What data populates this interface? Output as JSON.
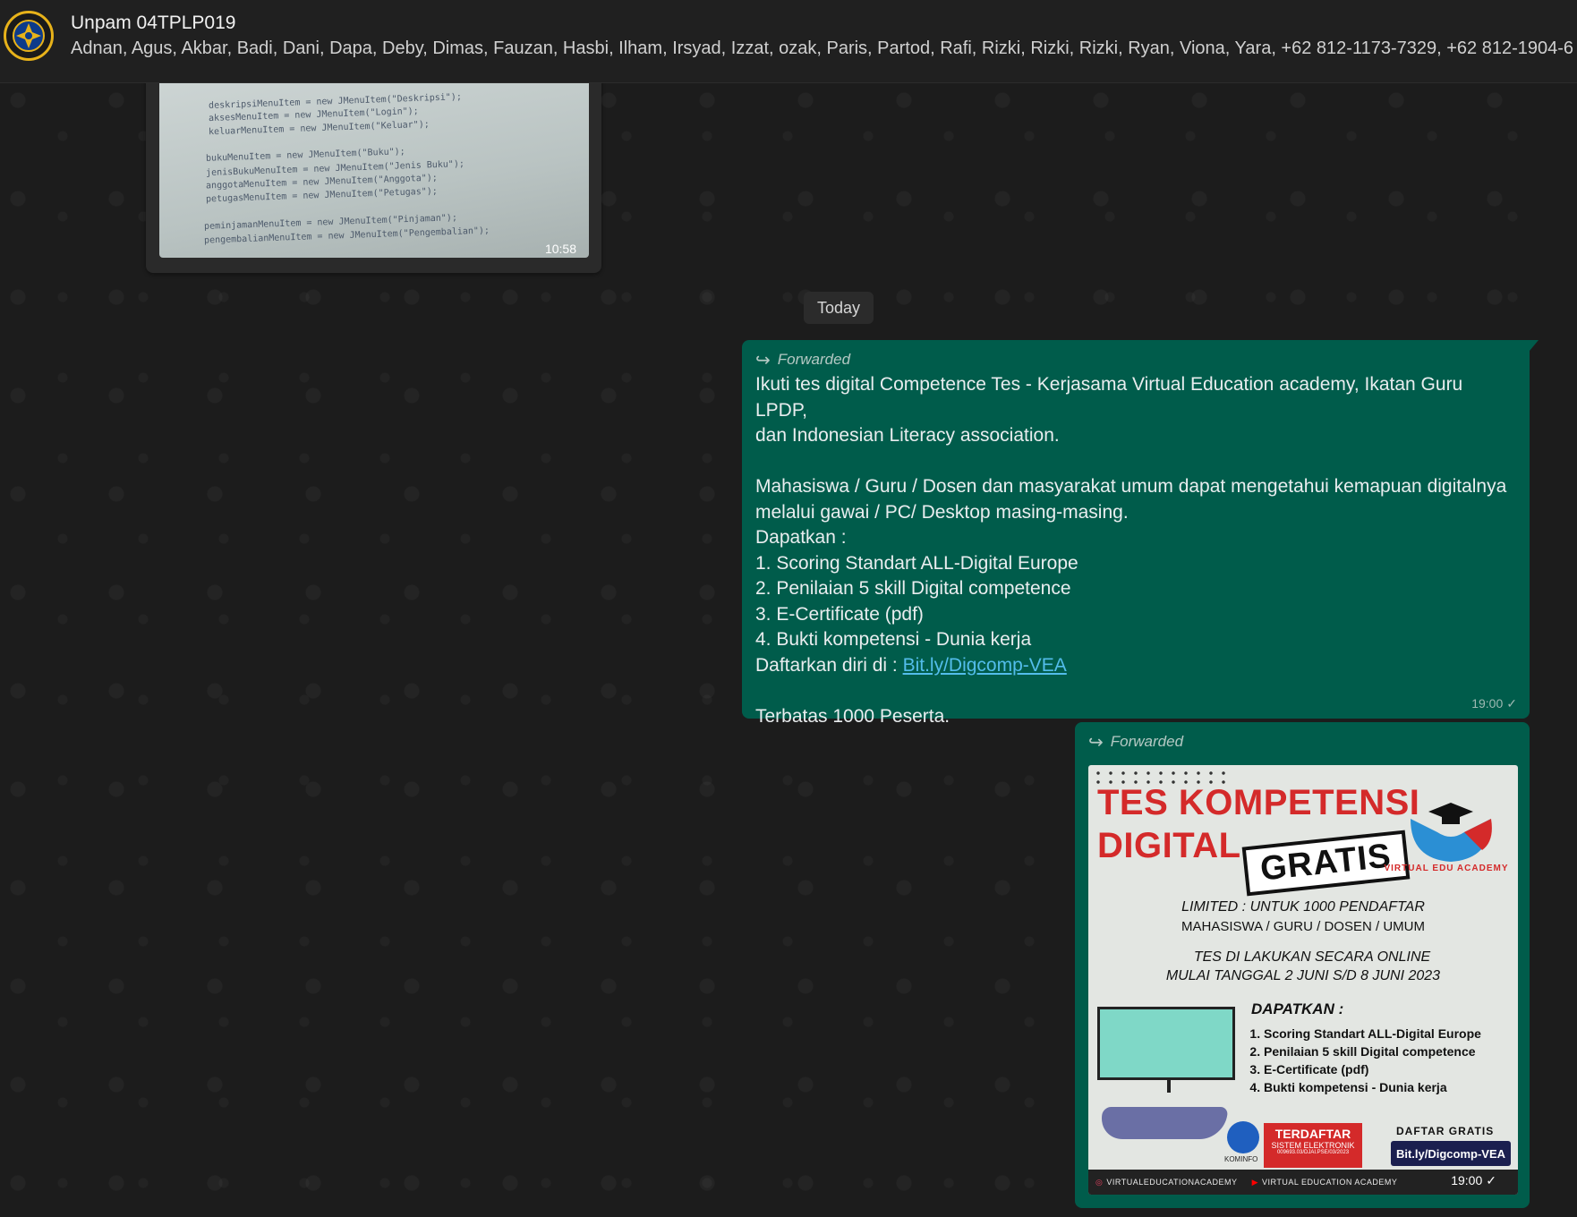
{
  "header": {
    "title": "Unpam 04TPLP019",
    "members": "Adnan, Agus, Akbar, Badi, Dani, Dapa, Deby, Dimas, Fauzan, Hasbi, Ilham, Irsyad, Izzat, ozak, Paris, Partod, Rafi, Rizki, Rizki, Rizki, Ryan, Viona, Yara, +62 812-1173-7329, +62 812-1904-6"
  },
  "old_image": {
    "time": "10:58",
    "code_lines": [
      "deskripsiMenuItem = new JMenuItem(\"Deskripsi\");",
      "aksesMenuItem = new JMenuItem(\"Login\");",
      "keluarMenuItem = new JMenuItem(\"Keluar\");",
      "bukuMenuItem = new JMenuItem(\"Buku\");",
      "jenisBukuMenuItem = new JMenuItem(\"Jenis Buku\");",
      "anggotaMenuItem = new JMenuItem(\"Anggota\");",
      "petugasMenuItem = new JMenuItem(\"Petugas\");",
      "peminjamanMenuItem = new JMenuItem(\"Pinjaman\");",
      "pengembalianMenuItem = new JMenuItem(\"Pengembalian\");"
    ]
  },
  "date_divider": "Today",
  "text_message": {
    "forwarded": "Forwarded",
    "line1": "Ikuti tes digital Competence Tes - Kerjasama Virtual Education academy, Ikatan Guru LPDP,",
    "line2": "dan Indonesian Literacy association.",
    "line3": "Mahasiswa / Guru / Dosen dan masyarakat umum dapat mengetahui kemapuan digitalnya",
    "line4": "melalui gawai / PC/ Desktop masing-masing.",
    "line5": "Dapatkan :",
    "item1": "1. Scoring Standart ALL-Digital Europe",
    "item2": "2. Penilaian 5 skill Digital competence",
    "item3": "3. E-Certificate (pdf)",
    "item4": "4. Bukti kompetensi - Dunia kerja",
    "register_prefix": "Daftarkan diri di : ",
    "register_link": "Bit.ly/Digcomp-VEA",
    "closing": "Terbatas 1000 Peserta.",
    "time": "19:00",
    "status": "✓"
  },
  "image_message": {
    "forwarded": "Forwarded",
    "time": "19:00",
    "status": "✓",
    "poster": {
      "title_line1": "TES KOMPETENSI",
      "title_line2": "DIGITAL",
      "gratis": "GRATIS",
      "logo_text": "VIRTUAL EDU ACADEMY",
      "limited": "LIMITED : UNTUK 1000 PENDAFTAR",
      "audience": "MAHASISWA / GURU / DOSEN / UMUM",
      "online": "TES DI LAKUKAN SECARA ONLINE",
      "dates": "MULAI TANGGAL 2 JUNI S/D 8 JUNI 2023",
      "dapatkan": "DAPATKAN  :",
      "items": [
        "Scoring Standart ALL-Digital Europe",
        "Penilaian 5 skill Digital competence",
        "E-Certificate (pdf)",
        "Bukti kompetensi - Dunia kerja"
      ],
      "kominfo": "KOMINFO",
      "registered": "TERDAFTAR",
      "registered_sub": "SISTEM ELEKTRONIK",
      "registered_no": "009693.03/DJAI.PSE/03/2023",
      "daftar_gratis": "DAFTAR GRATIS",
      "url": "Bit.ly/Digcomp-VEA",
      "instagram": "VIRTUALEDUCATIONACADEMY",
      "youtube": "VIRTUAL EDUCATION ACADEMY"
    }
  },
  "colors": {
    "outgoing_bubble": "#005c4b",
    "link": "#53bdeb",
    "poster_red": "#d42a2a"
  }
}
